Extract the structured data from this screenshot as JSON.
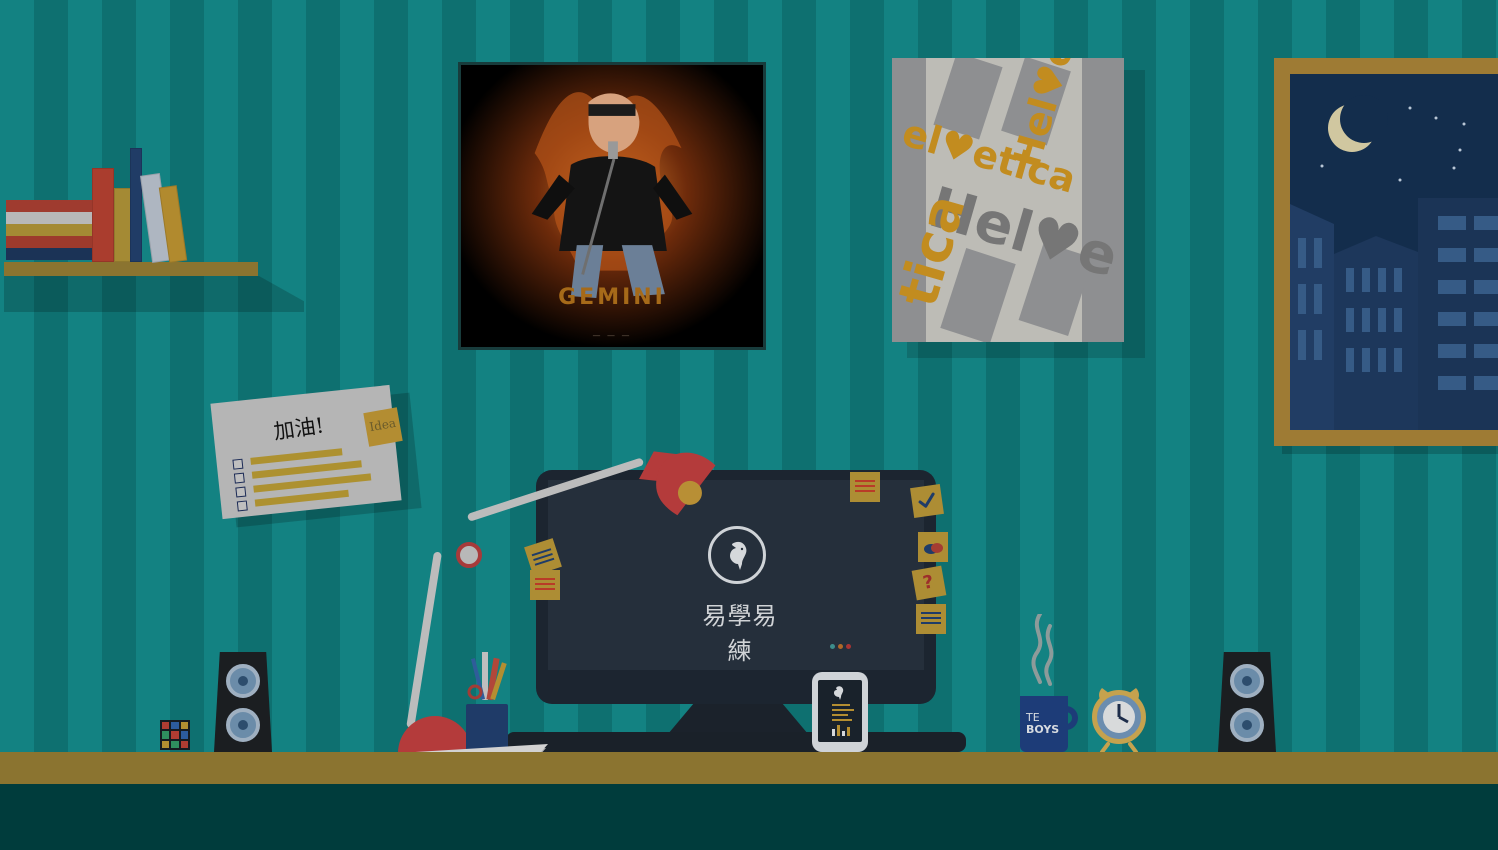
{
  "artwork": {
    "poster_title": "GEMINI",
    "note_title": "加油!",
    "idea_label": "Idea",
    "screen_brand": "易學易練",
    "mug_line1": "TE",
    "mug_line2": "BOYS"
  },
  "colors": {
    "wall_stripe_a": "#138282",
    "wall_stripe_b": "#0e7070",
    "desk": "#8b7430",
    "floor": "#003c3c",
    "monitor": "#1c2530",
    "lamp": "#b43b3b",
    "accent_yellow": "#b38d32"
  },
  "icons": {
    "screen_logo": "bird-logo-icon",
    "speaker": "speaker-icon",
    "clock": "alarm-clock-icon",
    "phone": "smartphone-icon"
  }
}
